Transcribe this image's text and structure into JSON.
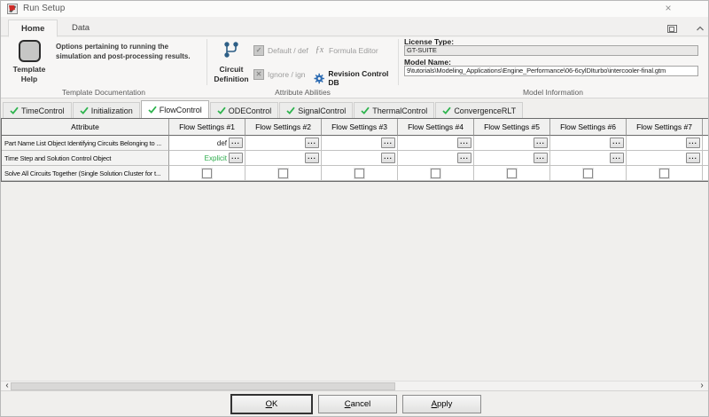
{
  "window": {
    "title": "Run Setup",
    "close_glyph": "×"
  },
  "ribbon_tabs": {
    "home": "Home",
    "data": "Data"
  },
  "template_documentation": {
    "group_label": "Template Documentation",
    "help_button": "Template Help",
    "description": "Options pertaining to running the simulation and post-processing results."
  },
  "attribute_abilities": {
    "group_label": "Attribute Abilities",
    "circuit_definition": "Circuit Definition",
    "default_def": "Default / def",
    "ignore_ign": "Ignore / ign",
    "formula_editor": "Formula Editor",
    "revision_control_db": "Revision Control DB",
    "default_glyph": "✓",
    "ignore_glyph": "✕",
    "formula_glyph": "ƒx"
  },
  "model_information": {
    "group_label": "Model Information",
    "license_type_label": "License Type:",
    "license_type_value": "GT-SUITE",
    "model_name_label": "Model Name:",
    "model_name_value": "9\\tutorials\\Modeling_Applications\\Engine_Performance\\06-6cylDIturbo\\intercooler-final.gtm"
  },
  "control_tabs": [
    {
      "label": "TimeControl"
    },
    {
      "label": "Initialization"
    },
    {
      "label": "FlowControl"
    },
    {
      "label": "ODEControl"
    },
    {
      "label": "SignalControl"
    },
    {
      "label": "ThermalControl"
    },
    {
      "label": "ConvergenceRLT"
    }
  ],
  "active_control_tab": "FlowControl",
  "table": {
    "attribute_header": "Attribute",
    "columns": [
      "Flow Settings #1",
      "Flow Settings #2",
      "Flow Settings #3",
      "Flow Settings #4",
      "Flow Settings #5",
      "Flow Settings #6",
      "Flow Settings #7"
    ],
    "ellipsis": "...",
    "rows": [
      {
        "attribute": "Part Name List Object Identifying Circuits Belonging to ...",
        "values": [
          "def",
          "",
          "",
          "",
          "",
          "",
          ""
        ]
      },
      {
        "attribute": "Time Step and Solution Control Object",
        "values": [
          "Explicit",
          "",
          "",
          "",
          "",
          "",
          ""
        ]
      },
      {
        "attribute": "Solve All Circuits Together (Single Solution Cluster for t...",
        "checkbox": true
      }
    ]
  },
  "footer": {
    "ok": "OK",
    "cancel": "Cancel",
    "apply": "Apply"
  },
  "colors": {
    "check_green": "#2eb44e",
    "explicit_green": "#2aab4a",
    "gear_blue": "#2f6db3",
    "circuit_blue": "#2e5f86",
    "title_icon_red": "#cf2b27"
  }
}
